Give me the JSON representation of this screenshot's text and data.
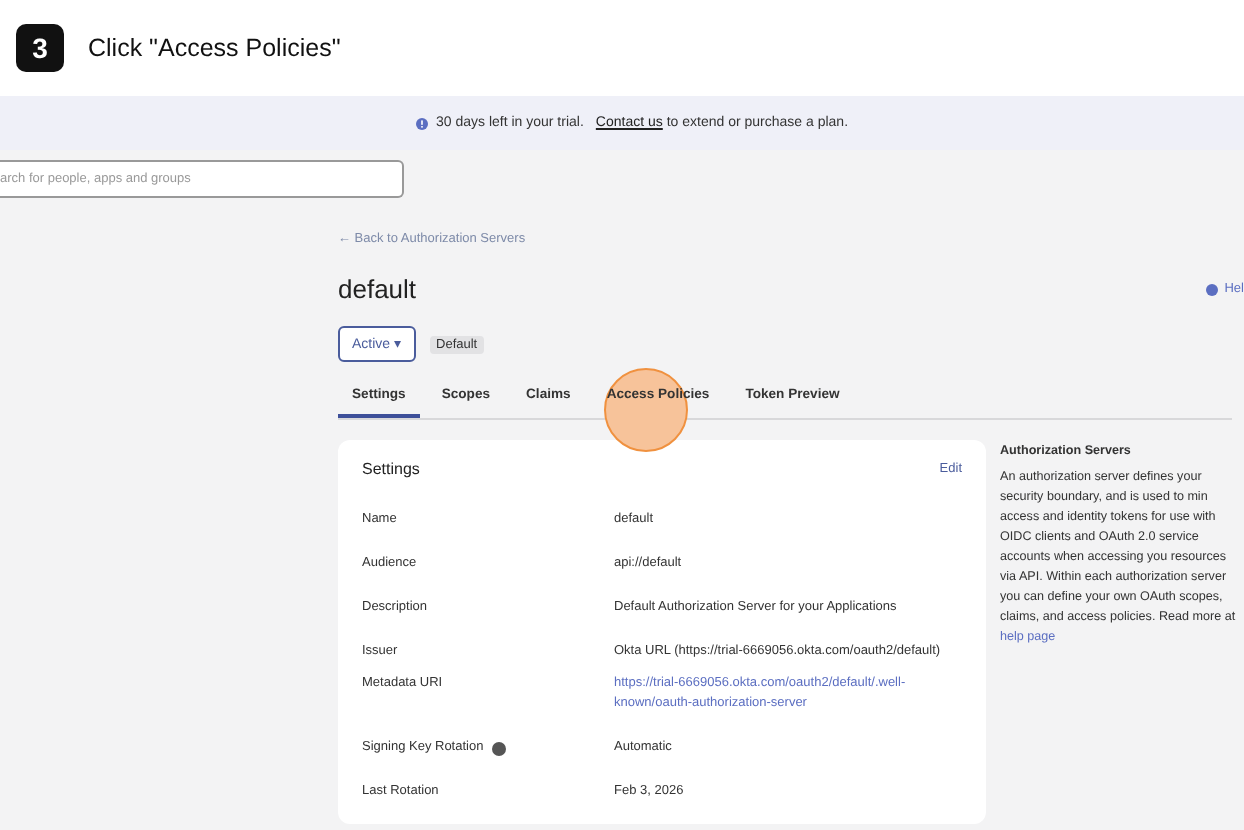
{
  "step": {
    "number": "3",
    "instruction": "Click \"Access Policies\""
  },
  "banner": {
    "text": "30 days left in your trial.",
    "link": "Contact us",
    "rest": "to extend or purchase a plan."
  },
  "search": {
    "placeholder": "arch for people, apps and groups"
  },
  "back_link": "← Back to Authorization Servers",
  "title": "default",
  "help": "Hel",
  "status": {
    "label": "Active",
    "caret": "▾"
  },
  "badge": "Default",
  "tabs": [
    {
      "label": "Settings",
      "selected": true
    },
    {
      "label": "Scopes",
      "selected": false
    },
    {
      "label": "Claims",
      "selected": false
    },
    {
      "label": "Access Policies",
      "selected": false,
      "highlighted": true
    },
    {
      "label": "Token Preview",
      "selected": false
    }
  ],
  "settings": {
    "title": "Settings",
    "edit": "Edit",
    "rows": [
      {
        "label": "Name",
        "value": "default"
      },
      {
        "label": "Audience",
        "value": "api://default"
      },
      {
        "label": "Description",
        "value": "Default Authorization Server for your Applications"
      },
      {
        "label": "Issuer",
        "value": "Okta URL (https://trial-6669056.okta.com/oauth2/default)"
      },
      {
        "label": "Metadata URI",
        "value": "https://trial-6669056.okta.com/oauth2/default/.well-known/oauth-authorization-server",
        "kind": "link"
      },
      {
        "label": "Signing Key Rotation",
        "value": "Automatic",
        "info": true
      },
      {
        "label": "Last Rotation",
        "value": "Feb 3, 2026"
      }
    ]
  },
  "sidebar": {
    "title": "Authorization Servers",
    "text": "An authorization server defines your security boundary, and is used to min access and identity tokens for use with OIDC clients and OAuth 2.0 service accounts when accessing you resources via API. Within each authorization server you can define your own OAuth scopes, claims, and access policies. Read more at",
    "link": "help page"
  }
}
